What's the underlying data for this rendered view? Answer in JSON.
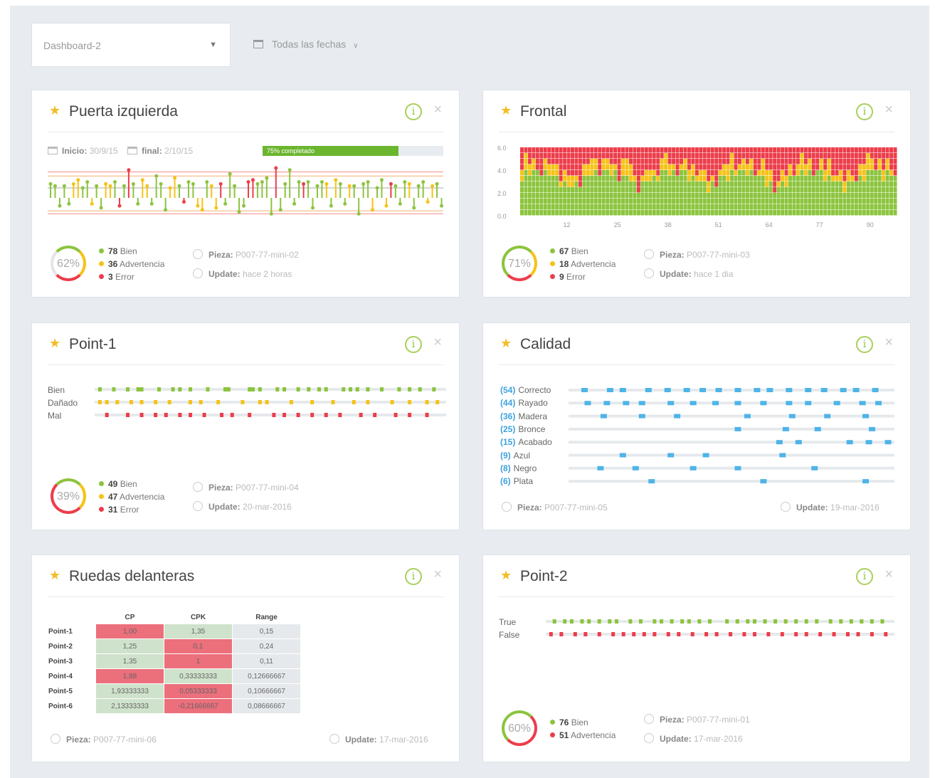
{
  "toolbar": {
    "dashboard": "Dashboard-2",
    "dates": "Todas las fechas"
  },
  "colors": {
    "green": "#8cc43e",
    "yellow": "#f5c318",
    "red": "#ec3d4a",
    "blue": "#4db4e8",
    "track": "#e6e9ec"
  },
  "icons": [
    "star-icon",
    "info-icon",
    "close-icon",
    "calendar-icon",
    "chevron-down-icon",
    "piece-icon",
    "clock-icon"
  ],
  "puerta": {
    "title": "Puerta izquierda",
    "start_label": "Inicio:",
    "start": "30/9/15",
    "end_label": "final:",
    "end": "2/10/15",
    "progress_label": "75% completado",
    "progress": 0.75,
    "gauge": "62%",
    "legend": [
      {
        "n": "78",
        "label": "Bien"
      },
      {
        "n": "36",
        "label": "Advertencia"
      },
      {
        "n": "3",
        "label": "Error"
      }
    ],
    "pieza_label": "Pieza:",
    "pieza": "P007-77-mini-02",
    "update_label": "Update:",
    "update": "hace 2 horas"
  },
  "frontal": {
    "title": "Frontal",
    "gauge": "71%",
    "legend": [
      {
        "n": "67",
        "label": "Bien"
      },
      {
        "n": "18",
        "label": "Advertencia"
      },
      {
        "n": "9",
        "label": "Error"
      }
    ],
    "pieza_label": "Pieza:",
    "pieza": "P007-77-mini-03",
    "update_label": "Update:",
    "update": "hace 1 dia"
  },
  "point1": {
    "title": "Point-1",
    "rows": [
      "Bien",
      "Dañado",
      "Mal"
    ],
    "gauge": "39%",
    "legend": [
      {
        "n": "49",
        "label": "Bien"
      },
      {
        "n": "47",
        "label": "Advertencia"
      },
      {
        "n": "31",
        "label": "Error"
      }
    ],
    "pieza_label": "Pieza:",
    "pieza": "P007-77-mini-04",
    "update_label": "Update:",
    "update": "20-mar-2016"
  },
  "calidad": {
    "title": "Calidad",
    "rows": [
      {
        "n": "(54)",
        "label": "Correcto"
      },
      {
        "n": "(44)",
        "label": "Rayado"
      },
      {
        "n": "(36)",
        "label": "Madera"
      },
      {
        "n": "(25)",
        "label": "Bronce"
      },
      {
        "n": "(15)",
        "label": "Acabado"
      },
      {
        "n": "(9)",
        "label": "Azul"
      },
      {
        "n": "(8)",
        "label": "Negro"
      },
      {
        "n": "(6)",
        "label": "Plata"
      }
    ],
    "pieza_label": "Pieza:",
    "pieza": "P007-77-mini-05",
    "update_label": "Update:",
    "update": "19-mar-2016"
  },
  "ruedas": {
    "title": "Ruedas delanteras",
    "columns": [
      "CP",
      "CPK",
      "Range"
    ],
    "rows": [
      {
        "name": "Point-1",
        "cells": [
          "1,00",
          "1,35",
          "0,15"
        ],
        "status": [
          "r",
          "g",
          "n"
        ]
      },
      {
        "name": "Point-2",
        "cells": [
          "1,25",
          "0,1",
          "0,24"
        ],
        "status": [
          "g",
          "r",
          "n"
        ]
      },
      {
        "name": "Point-3",
        "cells": [
          "1,35",
          "1",
          "0,11"
        ],
        "status": [
          "g",
          "r",
          "n"
        ]
      },
      {
        "name": "Point-4",
        "cells": [
          "1,88",
          "0,33333333",
          "0,12666667"
        ],
        "status": [
          "r",
          "g",
          "n"
        ]
      },
      {
        "name": "Point-5",
        "cells": [
          "1,93333333",
          "0,05333333",
          "0,10666667"
        ],
        "status": [
          "g",
          "r",
          "n"
        ]
      },
      {
        "name": "Point-6",
        "cells": [
          "2,13333333",
          "-0,21666667",
          "0,08666667"
        ],
        "status": [
          "g",
          "r",
          "n"
        ]
      }
    ],
    "pieza_label": "Pieza:",
    "pieza": "P007-77-mini-06",
    "update_label": "Update:",
    "update": "17-mar-2016"
  },
  "point2": {
    "title": "Point-2",
    "rows": [
      "True",
      "False"
    ],
    "gauge": "60%",
    "legend": [
      {
        "n": "76",
        "label": "Bien"
      },
      {
        "n": "51",
        "label": "Advertencia"
      }
    ],
    "pieza_label": "Pieza:",
    "pieza": "P007-77-mini-01",
    "update_label": "Update:",
    "update": "17-mar-2016"
  },
  "chart_data": [
    {
      "type": "scatter",
      "id": "puerta-lollipop",
      "series": [
        {
          "values": [
            0.7,
            0.6,
            -0.4,
            0.6,
            -0.3,
            0.7,
            0.9,
            0.5,
            0.8,
            -0.3,
            0.6,
            -0.5,
            0.7,
            0.6,
            0.8,
            -0.4,
            0.6,
            1.4,
            0.7,
            -0.3,
            0.9,
            0.6,
            -0.3,
            1.1,
            0.7,
            -0.6,
            0.5,
            1.0,
            0.6,
            -0.2,
            0.8,
            0.7,
            -0.4,
            -0.6,
            0.8,
            0.6,
            -0.5,
            0.7,
            -0.3,
            1.2,
            0.6,
            -0.7,
            -0.4,
            0.8,
            0.9,
            0.7,
            0.8,
            1.0,
            -0.8,
            1.5,
            -0.6,
            0.7,
            1.4,
            -0.3,
            0.8,
            0.7,
            0.8,
            -0.5,
            0.6,
            0.8,
            0.7,
            -0.4,
            0.9,
            0.7,
            -0.3,
            0.6,
            0.6,
            -0.8,
            0.7,
            0.8,
            -0.6,
            0.5,
            0.9,
            -0.4,
            0.7,
            0.6,
            -0.3,
            0.8,
            0.7,
            -0.5,
            0.6,
            0.8,
            -0.2,
            0.6,
            0.7,
            -0.4
          ]
        },
        {
          "status": "gggggyyggyggyygrgrggyyggggyygrggyygyyrgggggrrggggrgggggrggggygyggyggggyggyrgggygggyyg"
        }
      ]
    },
    {
      "type": "heatmap",
      "id": "frontal-heatmap",
      "x_ticks": [
        12,
        25,
        38,
        51,
        64,
        77,
        90
      ],
      "y_ticks": [
        "0.0",
        "2.0",
        "4.0",
        "6.0"
      ],
      "ylim": [
        0,
        6
      ],
      "columns": 97,
      "segments": [
        0.18,
        0.82,
        1.25,
        0.62,
        0.34,
        0.71,
        1.12,
        0.59
      ]
    },
    {
      "type": "scatter",
      "id": "point1-strip",
      "categories": [
        "Bien",
        "Dañado",
        "Mal"
      ],
      "series": [
        {
          "name": "Bien",
          "values": [
            0.01,
            0.05,
            0.09,
            0.12,
            0.13,
            0.18,
            0.22,
            0.24,
            0.27,
            0.32,
            0.37,
            0.38,
            0.44,
            0.45,
            0.47,
            0.52,
            0.54,
            0.58,
            0.61,
            0.64,
            0.66,
            0.71,
            0.73,
            0.75,
            0.78,
            0.82,
            0.87,
            0.9,
            0.93,
            0.97
          ]
        },
        {
          "name": "Dañado",
          "values": [
            0.01,
            0.03,
            0.06,
            0.1,
            0.13,
            0.17,
            0.21,
            0.27,
            0.3,
            0.35,
            0.42,
            0.47,
            0.49,
            0.56,
            0.62,
            0.68,
            0.74,
            0.78,
            0.85,
            0.9,
            0.95,
            0.98
          ]
        },
        {
          "name": "Mal",
          "values": [
            0.03,
            0.09,
            0.13,
            0.17,
            0.2,
            0.24,
            0.27,
            0.31,
            0.36,
            0.39,
            0.44,
            0.51,
            0.54,
            0.58,
            0.62,
            0.66,
            0.7,
            0.76,
            0.8,
            0.86,
            0.9,
            0.95
          ]
        }
      ]
    },
    {
      "type": "scatter",
      "id": "calidad-strip",
      "categories": [
        "Correcto",
        "Rayado",
        "Madera",
        "Bronce",
        "Acabado",
        "Azul",
        "Negro",
        "Plata"
      ],
      "series": [
        {
          "name": "Correcto",
          "values": [
            0.04,
            0.12,
            0.16,
            0.24,
            0.3,
            0.36,
            0.41,
            0.46,
            0.52,
            0.58,
            0.62,
            0.68,
            0.74,
            0.79,
            0.85,
            0.89,
            0.95
          ]
        },
        {
          "name": "Rayado",
          "values": [
            0.05,
            0.11,
            0.17,
            0.22,
            0.31,
            0.38,
            0.45,
            0.52,
            0.6,
            0.68,
            0.74,
            0.83,
            0.91,
            0.96
          ]
        },
        {
          "name": "Madera",
          "values": [
            0.1,
            0.22,
            0.33,
            0.55,
            0.69,
            0.8,
            0.92
          ]
        },
        {
          "name": "Bronce",
          "values": [
            0.52,
            0.67,
            0.77,
            0.94
          ]
        },
        {
          "name": "Acabado",
          "values": [
            0.65,
            0.71,
            0.87,
            0.93,
            0.99
          ]
        },
        {
          "name": "Azul",
          "values": [
            0.16,
            0.31,
            0.42,
            0.66
          ]
        },
        {
          "name": "Negro",
          "values": [
            0.09,
            0.2,
            0.38,
            0.52,
            0.76
          ]
        },
        {
          "name": "Plata",
          "values": [
            0.25,
            0.6,
            0.92
          ]
        }
      ]
    },
    {
      "type": "scatter",
      "id": "point2-strip",
      "categories": [
        "True",
        "False"
      ],
      "series": [
        {
          "name": "True",
          "values": [
            0.02,
            0.05,
            0.07,
            0.1,
            0.12,
            0.15,
            0.18,
            0.2,
            0.24,
            0.27,
            0.31,
            0.33,
            0.36,
            0.39,
            0.41,
            0.44,
            0.47,
            0.52,
            0.55,
            0.58,
            0.6,
            0.63,
            0.66,
            0.69,
            0.72,
            0.75,
            0.78,
            0.82,
            0.85,
            0.88,
            0.91,
            0.94,
            0.97
          ]
        },
        {
          "name": "False",
          "values": [
            0.01,
            0.04,
            0.08,
            0.11,
            0.15,
            0.19,
            0.22,
            0.25,
            0.28,
            0.31,
            0.35,
            0.38,
            0.42,
            0.46,
            0.49,
            0.53,
            0.57,
            0.6,
            0.64,
            0.68,
            0.72,
            0.75,
            0.79,
            0.83,
            0.87,
            0.9,
            0.94,
            0.98
          ]
        }
      ]
    }
  ]
}
